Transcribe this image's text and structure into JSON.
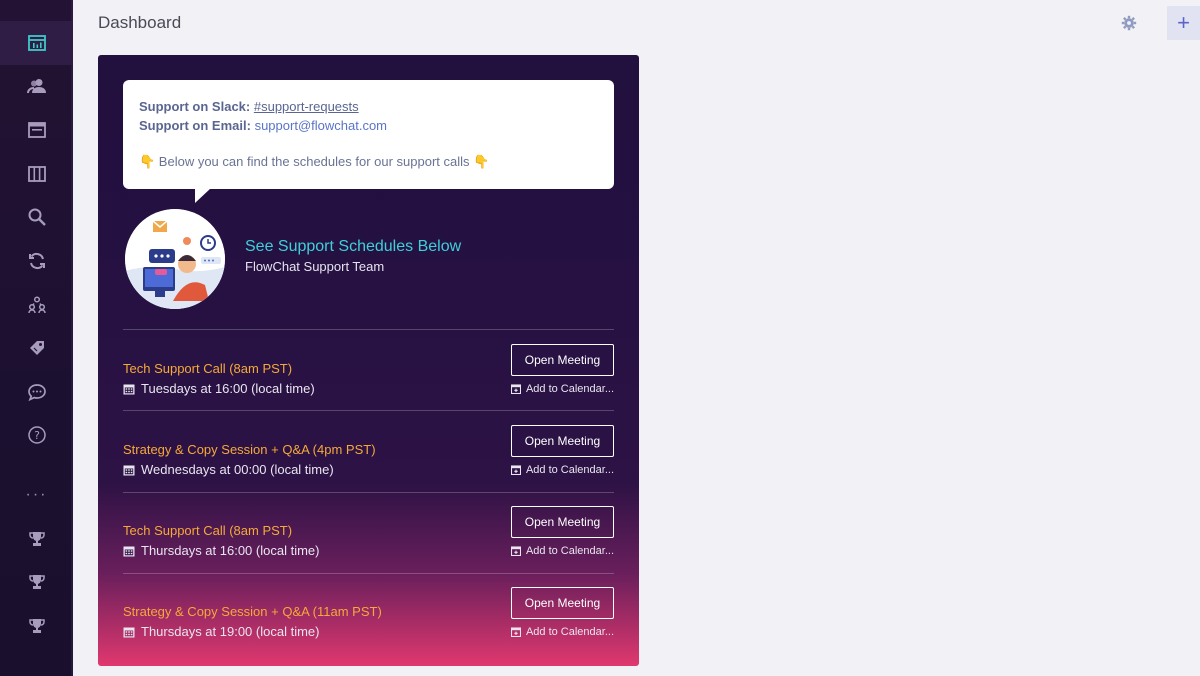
{
  "header": {
    "title": "Dashboard",
    "add_label": "+"
  },
  "sidebar": {
    "items": [
      {
        "icon": "dashboard-icon"
      },
      {
        "icon": "users-icon"
      },
      {
        "icon": "browser-window-icon"
      },
      {
        "icon": "columns-icon"
      },
      {
        "icon": "search-icon"
      },
      {
        "icon": "sync-icon"
      },
      {
        "icon": "hierarchy-icon"
      },
      {
        "icon": "tag-icon"
      },
      {
        "icon": "chat-icon"
      },
      {
        "icon": "help-icon"
      }
    ],
    "more_label": "···",
    "bottom": [
      {
        "icon": "trophy-icon"
      },
      {
        "icon": "trophy-icon"
      },
      {
        "icon": "trophy-icon"
      }
    ]
  },
  "support": {
    "slack_label": "Support on Slack:",
    "slack_value": "#support-requests",
    "email_label": "Support on Email:",
    "email_value": "support@flowchat.com",
    "note": "👇 Below you can find the schedules for our support calls 👇",
    "team_title": "See Support Schedules Below",
    "team_sub": "FlowChat Support Team"
  },
  "sessions": [
    {
      "title": "Tech Support Call (8am PST)",
      "time": "Tuesdays at 16:00 (local time)",
      "button": "Open Meeting",
      "calendar": "Add to Calendar..."
    },
    {
      "title": "Strategy & Copy Session + Q&A (4pm PST)",
      "time": "Wednesdays at 00:00 (local time)",
      "button": "Open Meeting",
      "calendar": "Add to Calendar..."
    },
    {
      "title": "Tech Support Call (8am PST)",
      "time": "Thursdays at 16:00 (local time)",
      "button": "Open Meeting",
      "calendar": "Add to Calendar..."
    },
    {
      "title": "Strategy & Copy Session + Q&A (11am PST)",
      "time": "Thursdays at 19:00 (local time)",
      "button": "Open Meeting",
      "calendar": "Add to Calendar..."
    }
  ],
  "colors": {
    "accent_teal": "#3ecfd9",
    "session_title": "#f5a93a",
    "sidebar_bg": "#231233"
  }
}
